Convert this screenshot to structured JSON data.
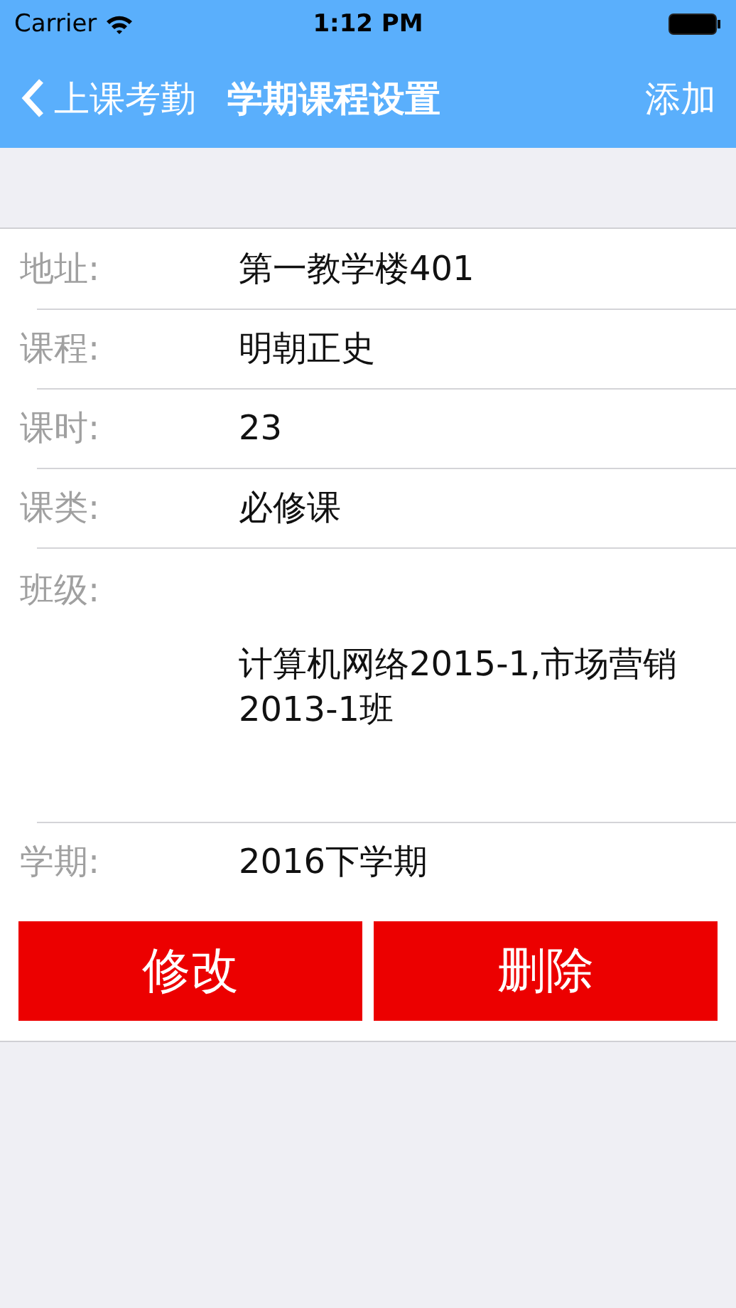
{
  "status_bar": {
    "carrier": "Carrier",
    "time": "1:12 PM"
  },
  "nav": {
    "back": "上课考勤",
    "title": "学期课程设置",
    "action": "添加"
  },
  "fields": [
    {
      "kind": "line",
      "label": "地址:",
      "value": "第一教学楼401"
    },
    {
      "kind": "line",
      "label": "课程:",
      "value": "明朝正史"
    },
    {
      "kind": "line",
      "label": "课时:",
      "value": "23"
    },
    {
      "kind": "line",
      "label": "课类:",
      "value": "必修课"
    },
    {
      "kind": "tall",
      "label": "班级:",
      "value": "计算机网络2015-1,市场营销2013-1班"
    },
    {
      "kind": "line",
      "label": "学期:",
      "value": "2016下学期"
    }
  ],
  "buttons": [
    "修改",
    "删除"
  ]
}
